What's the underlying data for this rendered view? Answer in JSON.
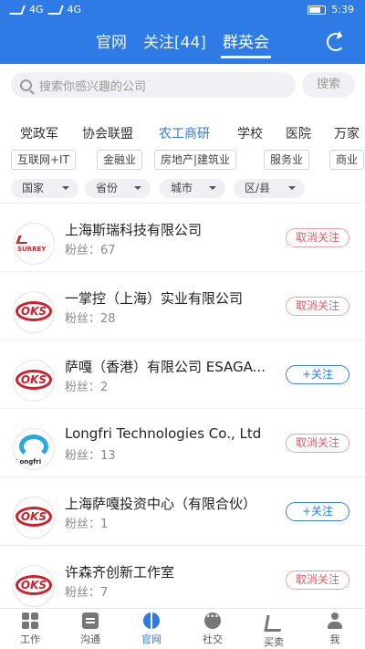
{
  "status_bar": {
    "network_left": "4G",
    "network_right": "4G",
    "time": "5:39"
  },
  "header": {
    "tabs": [
      {
        "label": "官网",
        "active": false
      },
      {
        "label": "关注[44]",
        "active": false
      },
      {
        "label": "群英会",
        "active": true
      }
    ],
    "refresh_icon": "refresh-icon",
    "accent_color": "#2e7be6"
  },
  "search": {
    "placeholder": "搜索你感兴趣的公司",
    "button_label": "搜索"
  },
  "categories": [
    {
      "label": "党政军",
      "active": false
    },
    {
      "label": "协会联盟",
      "active": false
    },
    {
      "label": "农工商研",
      "active": true
    },
    {
      "label": "学校",
      "active": false
    },
    {
      "label": "医院",
      "active": false
    },
    {
      "label": "万家",
      "active": false
    }
  ],
  "industry_chips": [
    "互联网+IT",
    "金融业",
    "房地产|建筑业",
    "服务业",
    "商业"
  ],
  "filters": [
    "国家",
    "省份",
    "城市",
    "区/县"
  ],
  "companies": [
    {
      "name": "上海斯瑞科技有限公司",
      "fans_label": "粉丝：67",
      "button": "取消关注",
      "followed": true,
      "logo": "surrey-logo",
      "logo_text": "SURREY"
    },
    {
      "name": "一掌控（上海）实业有限公司",
      "fans_label": "粉丝：28",
      "button": "取消关注",
      "followed": true,
      "logo": "oks-logo",
      "logo_text": "OKS"
    },
    {
      "name": "萨嘎（香港）有限公司 ESAGA...",
      "fans_label": "粉丝：2",
      "button": "+关注",
      "followed": false,
      "logo": "oks-logo",
      "logo_text": "OKS"
    },
    {
      "name": "Longfri Technologies Co., Ltd",
      "fans_label": "粉丝：13",
      "button": "取消关注",
      "followed": true,
      "logo": "longfri-logo",
      "logo_text": "Longfri"
    },
    {
      "name": "上海萨嘎投资中心（有限合伙）",
      "fans_label": "粉丝：1",
      "button": "+关注",
      "followed": false,
      "logo": "oks-logo",
      "logo_text": "OKS"
    },
    {
      "name": "许森齐创新工作室",
      "fans_label": "粉丝：7",
      "button": "取消关注",
      "followed": true,
      "logo": "oks-logo",
      "logo_text": "OKS"
    }
  ],
  "bottom_nav": [
    {
      "label": "工作",
      "icon": "grid-icon",
      "active": false
    },
    {
      "label": "沟通",
      "icon": "chat-icon",
      "active": false
    },
    {
      "label": "官网",
      "icon": "basketball-icon",
      "active": true
    },
    {
      "label": "社交",
      "icon": "bubble-icon",
      "active": false
    },
    {
      "label": "买卖",
      "icon": "cart-icon",
      "active": false
    },
    {
      "label": "我",
      "icon": "user-icon",
      "active": false
    }
  ]
}
